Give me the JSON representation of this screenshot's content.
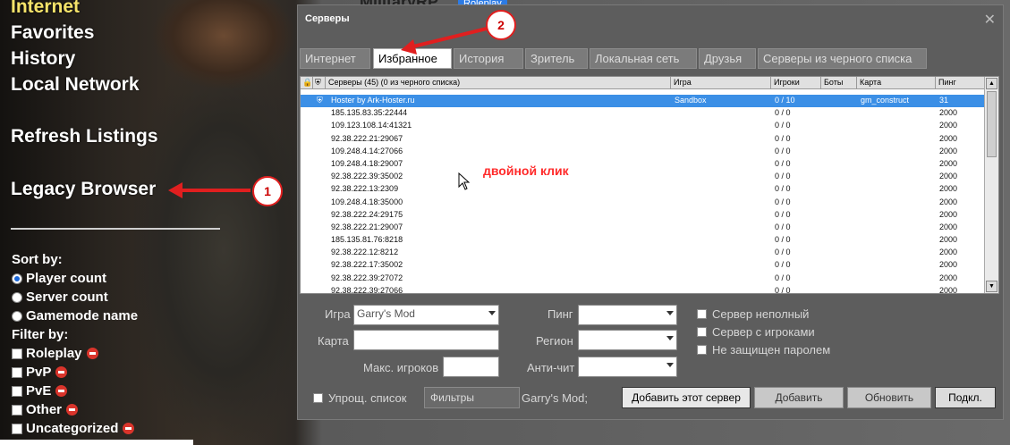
{
  "left_menu": {
    "items": [
      {
        "label": "Internet",
        "active": true
      },
      {
        "label": "Favorites"
      },
      {
        "label": "History"
      },
      {
        "label": "Local Network"
      },
      {
        "label": "Refresh Listings"
      },
      {
        "label": "Legacy Browser"
      }
    ]
  },
  "sort": {
    "heading": "Sort by:",
    "options": [
      {
        "label": "Player count",
        "selected": true
      },
      {
        "label": "Server count",
        "selected": false
      },
      {
        "label": "Gamemode name",
        "selected": false
      }
    ]
  },
  "filter": {
    "heading": "Filter by:",
    "options": [
      "Roleplay",
      "PvP",
      "PvE",
      "Other",
      "Uncategorized"
    ]
  },
  "background_page": {
    "title": "MilitaryRP",
    "tag": "Roleplay"
  },
  "dialog": {
    "title": "Серверы",
    "close": "✕",
    "tabs": [
      "Интернет",
      "Избранное",
      "История",
      "Зритель",
      "Локальная сеть",
      "Друзья",
      "Серверы из черного списка"
    ],
    "selected_tab": "Избранное",
    "columns": {
      "servers": "Серверы (45) (0 из черного списка)",
      "game": "Игра",
      "players": "Игроки",
      "bots": "Боты",
      "map": "Карта",
      "ping": "Пинг"
    },
    "rows": [
      {
        "name": "Hoster by Ark-Hoster.ru",
        "game": "Sandbox",
        "players": "0 / 10",
        "map": "gm_construct",
        "ping": "31"
      },
      {
        "name": "185.135.83.35:22444",
        "players": "0 / 0",
        "ping": "2000"
      },
      {
        "name": "109.123.108.14:41321",
        "players": "0 / 0",
        "ping": "2000"
      },
      {
        "name": "92.38.222.21:29067",
        "players": "0 / 0",
        "ping": "2000"
      },
      {
        "name": "109.248.4.14:27066",
        "players": "0 / 0",
        "ping": "2000"
      },
      {
        "name": "109.248.4.18:29007",
        "players": "0 / 0",
        "ping": "2000"
      },
      {
        "name": "92.38.222.39:35002",
        "players": "0 / 0",
        "ping": "2000"
      },
      {
        "name": "92.38.222.13:2309",
        "players": "0 / 0",
        "ping": "2000"
      },
      {
        "name": "109.248.4.18:35000",
        "players": "0 / 0",
        "ping": "2000"
      },
      {
        "name": "92.38.222.24:29175",
        "players": "0 / 0",
        "ping": "2000"
      },
      {
        "name": "92.38.222.21:29007",
        "players": "0 / 0",
        "ping": "2000"
      },
      {
        "name": "185.135.81.76:8218",
        "players": "0 / 0",
        "ping": "2000"
      },
      {
        "name": "92.38.222.12:8212",
        "players": "0 / 0",
        "ping": "2000"
      },
      {
        "name": "92.38.222.17:35002",
        "players": "0 / 0",
        "ping": "2000"
      },
      {
        "name": "92.38.222.39:27072",
        "players": "0 / 0",
        "ping": "2000"
      },
      {
        "name": "92.38.222.39:27066",
        "players": "0 / 0",
        "ping": "2000"
      }
    ],
    "hint": "двойной клик",
    "form": {
      "game_label": "Игра",
      "game_value": "Garry's Mod",
      "map_label": "Карта",
      "map_value": "",
      "maxplayers_label": "Макс. игроков",
      "maxplayers_value": "",
      "ping_label": "Пинг",
      "ping_value": "",
      "region_label": "Регион",
      "region_value": "",
      "anticheat_label": "Анти-чит",
      "anticheat_value": "",
      "check_not_full": "Сервер неполный",
      "check_has_players": "Сервер с игроками",
      "check_no_password": "Не защищен паролем",
      "simple_list": "Упрощ. список",
      "filters_button": "Фильтры",
      "filter_summary": "Garry's Mod;",
      "add_this_server": "Добавить этот сервер",
      "add": "Добавить",
      "refresh": "Обновить",
      "connect": "Подкл."
    }
  },
  "annotations": {
    "badge1": "1",
    "badge2": "2"
  }
}
